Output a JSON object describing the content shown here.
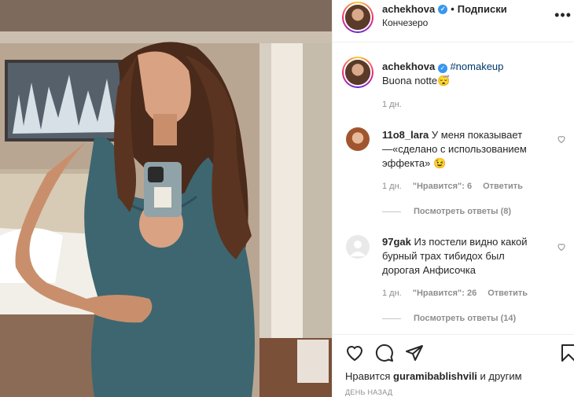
{
  "post": {
    "author": "achekhova",
    "location": "Кончезеро",
    "follow_sep": "•",
    "follow_label": "Подписки",
    "more_label": "•••"
  },
  "caption": {
    "author": "achekhova",
    "hashtag": "#nomakeup",
    "text": "Buona notte😴",
    "age": "1 дн."
  },
  "comments": [
    {
      "user": "11o8_lara",
      "line1": "У меня показывает",
      "line2": "—«сделано с использованием",
      "line3": "эффекта» 😉",
      "age": "1 дн.",
      "likes": "\"Нравится\": 6",
      "reply": "Ответить",
      "view_replies": "Посмотреть ответы (8)"
    },
    {
      "user": "97gak",
      "line1": "Из постели видно какой",
      "line2": "бурный трах тибидох был",
      "line3": "дорогая Анфисочка",
      "age": "1 дн.",
      "likes": "\"Нравится\": 26",
      "reply": "Ответить",
      "view_replies": "Посмотреть ответы (14)"
    }
  ],
  "footer": {
    "likes_prefix": "Нравится",
    "likes_user": "guramibablishvili",
    "likes_suffix": "и другим",
    "when": "ДЕНЬ НАЗАД"
  },
  "colors": {
    "verified": "#3897f0",
    "hashtag": "#00376b",
    "muted": "#8e8e8e"
  },
  "icons": [
    "verified-icon",
    "heart-icon",
    "comment-icon",
    "share-icon",
    "bookmark-icon",
    "more-icon"
  ]
}
